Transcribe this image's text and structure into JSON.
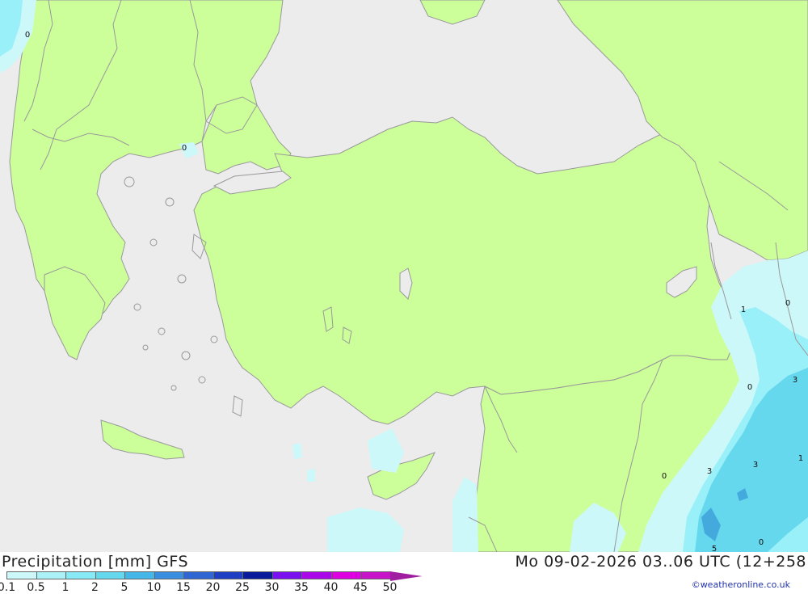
{
  "map": {
    "sea_color": "#ececec",
    "land_color": "#ccff99",
    "border_color": "#999999",
    "precip_light_color": "#ccf8fa",
    "precip_mid_color": "#99f0f8",
    "precip_heavy_color": "#66d8ee",
    "precip_peak_color": "#44aadd",
    "value_labels": [
      {
        "text": "0"
      },
      {
        "text": "0"
      },
      {
        "text": "1"
      },
      {
        "text": "0"
      },
      {
        "text": "0"
      },
      {
        "text": "3"
      },
      {
        "text": "1"
      },
      {
        "text": "0"
      },
      {
        "text": "3"
      },
      {
        "text": "3"
      },
      {
        "text": "5"
      },
      {
        "text": "0"
      }
    ]
  },
  "footer": {
    "title": "Precipitation [mm] GFS",
    "date": "Mo 09-02-2026 03..06 UTC (12+258",
    "credit": "©weatheronline.co.uk"
  },
  "legend": {
    "items": [
      {
        "label": "0.1",
        "color": "#ccf8fa"
      },
      {
        "label": "0.5",
        "color": "#aaf2f8"
      },
      {
        "label": "1",
        "color": "#88eaf4"
      },
      {
        "label": "2",
        "color": "#66d8ee"
      },
      {
        "label": "5",
        "color": "#44b6e8"
      },
      {
        "label": "10",
        "color": "#3a8ee0"
      },
      {
        "label": "15",
        "color": "#2f66d4"
      },
      {
        "label": "20",
        "color": "#1e3ec4"
      },
      {
        "label": "25",
        "color": "#0a1a9c"
      },
      {
        "label": "30",
        "color": "#7a10f0"
      },
      {
        "label": "35",
        "color": "#aa08e8"
      },
      {
        "label": "40",
        "color": "#dd00e0"
      },
      {
        "label": "45",
        "color": "#c814c8"
      },
      {
        "label": "50",
        "color": "#a01ca0"
      }
    ]
  }
}
